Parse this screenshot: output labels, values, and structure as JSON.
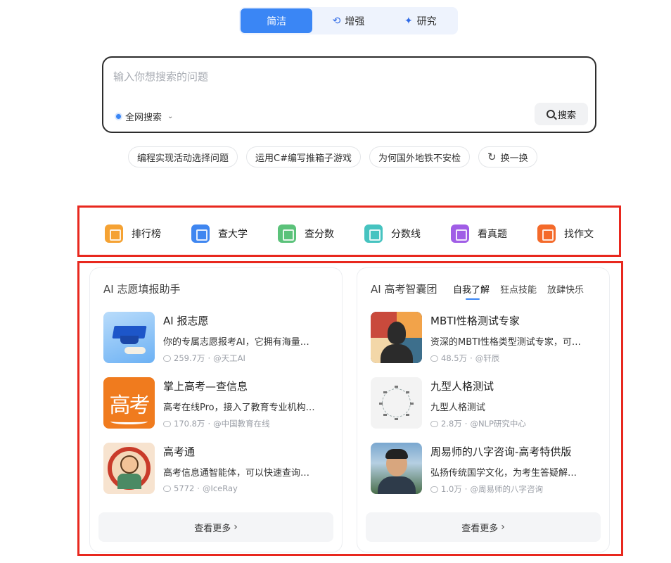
{
  "mode_tabs": [
    {
      "label": "简洁",
      "icon": "",
      "active": true
    },
    {
      "label": "增强",
      "icon": "enhance-icon",
      "active": false
    },
    {
      "label": "研究",
      "icon": "sparkle-icon",
      "active": false
    }
  ],
  "search": {
    "placeholder": "输入你想搜索的问题",
    "scope_label": "全网搜索",
    "button_label": "搜索"
  },
  "suggestions": [
    "编程实现活动选择问题",
    "运用C#编写推箱子游戏",
    "为何国外地铁不安检"
  ],
  "refresh_label": "换一换",
  "tools": [
    {
      "label": "排行榜",
      "color": "#f5a233"
    },
    {
      "label": "查大学",
      "color": "#3f86f0"
    },
    {
      "label": "查分数",
      "color": "#5bc27a"
    },
    {
      "label": "分数线",
      "color": "#46c3c0"
    },
    {
      "label": "看真题",
      "color": "#a05de6"
    },
    {
      "label": "找作文",
      "color": "#f46a2a"
    }
  ],
  "left_panel": {
    "title": "AI 志愿填报助手",
    "items": [
      {
        "name": "AI 报志愿",
        "desc": "你的专属志愿报考AI，它拥有海量…",
        "count": "259.7万",
        "author": "@天工AI"
      },
      {
        "name": "掌上高考—查信息",
        "desc": "高考在线Pro，接入了教育专业机构…",
        "count": "170.8万",
        "author": "@中国教育在线"
      },
      {
        "name": "高考通",
        "desc": "高考信息通智能体，可以快速查询…",
        "count": "5772",
        "author": "@IceRay"
      }
    ],
    "thumb_text_1": "高考",
    "more_label": "查看更多"
  },
  "right_panel": {
    "title": "AI 高考智囊团",
    "tabs": [
      {
        "label": "自我了解",
        "active": true
      },
      {
        "label": "狂点技能",
        "active": false
      },
      {
        "label": "放肆快乐",
        "active": false
      }
    ],
    "items": [
      {
        "name": "MBTI性格测试专家",
        "desc": "资深的MBTI性格类型测试专家，可…",
        "count": "48.5万",
        "author": "@轩辰"
      },
      {
        "name": "九型人格测试",
        "desc": "九型人格测试",
        "count": "2.8万",
        "author": "@NLP研究中心"
      },
      {
        "name": "周易师的八字咨询-高考特供版",
        "desc": "弘扬传统国学文化，为考生答疑解…",
        "count": "1.0万",
        "author": "@周易师的八字咨询"
      }
    ],
    "more_label": "查看更多"
  }
}
